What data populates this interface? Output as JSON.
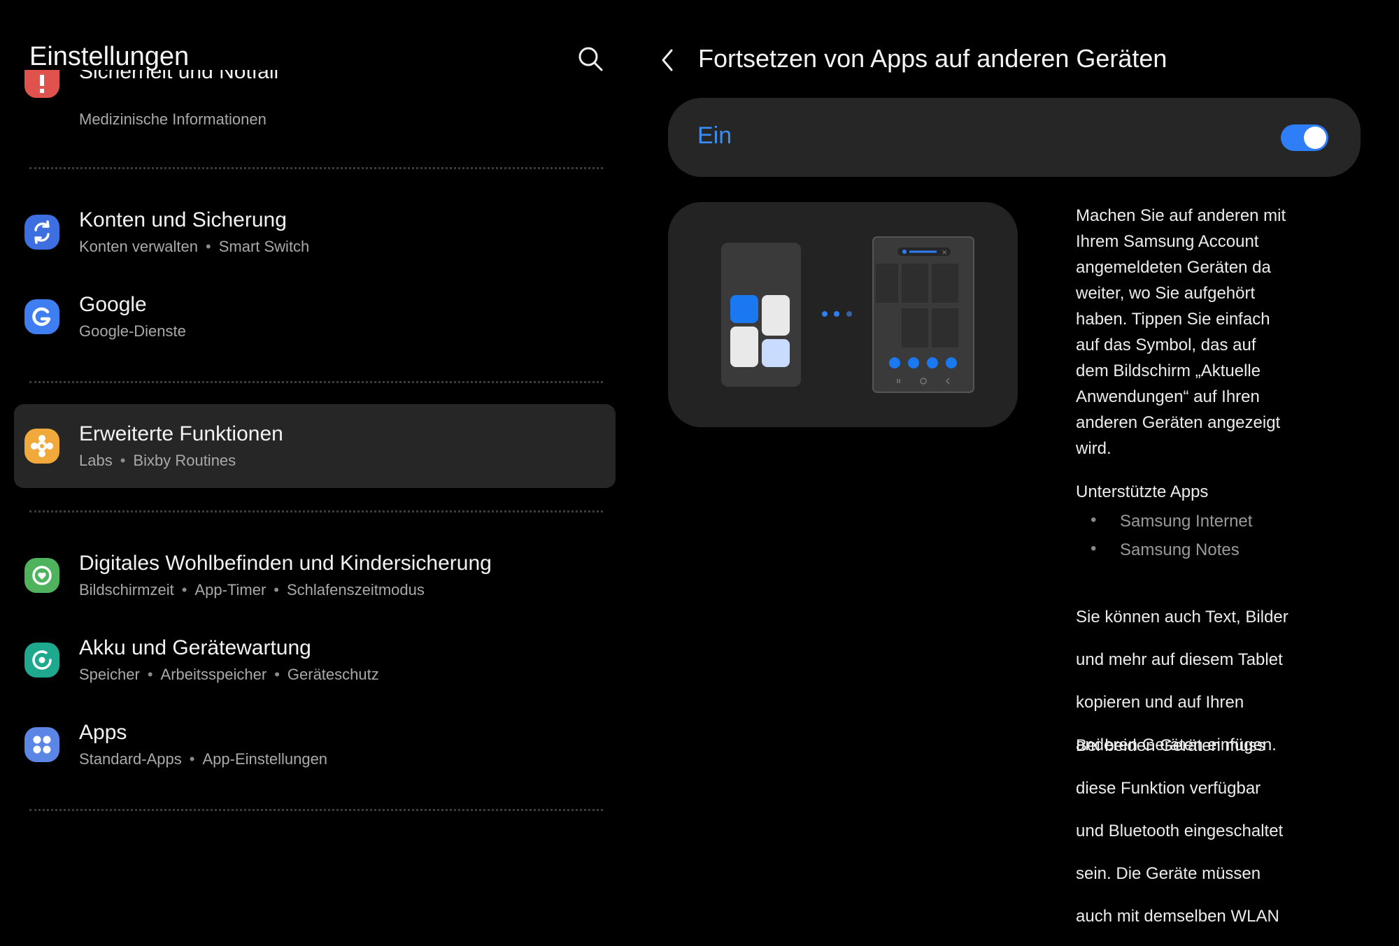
{
  "left": {
    "title": "Einstellungen",
    "partial_item": {
      "title": "Sicherheit und Notfall",
      "subtitle": "Medizinische Informationen"
    },
    "items": [
      {
        "title": "Konten und Sicherung",
        "subtitle": [
          "Konten verwalten",
          "Smart Switch"
        ],
        "icon": "sync-icon",
        "color": "#3d6fe0"
      },
      {
        "title": "Google",
        "subtitle": [
          "Google-Dienste"
        ],
        "icon": "google-icon",
        "color": "#3f7ef0"
      },
      {
        "title": "Erweiterte Funktionen",
        "subtitle": [
          "Labs",
          "Bixby Routines"
        ],
        "icon": "puzzle-gear-icon",
        "color": "#f0a93a",
        "selected": true
      },
      {
        "title": "Digitales Wohlbefinden und Kindersicherung",
        "subtitle": [
          "Bildschirmzeit",
          "App-Timer",
          "Schlafenszeitmodus"
        ],
        "icon": "heart-ring-icon",
        "color": "#4fb35e"
      },
      {
        "title": "Akku und Gerätewartung",
        "subtitle": [
          "Speicher",
          "Arbeitsspeicher",
          "Geräteschutz"
        ],
        "icon": "device-care-icon",
        "color": "#1ea88e"
      },
      {
        "title": "Apps",
        "subtitle": [
          "Standard-Apps",
          "App-Einstellungen"
        ],
        "icon": "apps-grid-icon",
        "color": "#5b86e6"
      }
    ]
  },
  "right": {
    "title": "Fortsetzen von Apps auf anderen Geräten",
    "toggle": {
      "label": "Ein",
      "state": "on",
      "color": "#2d7ef7"
    },
    "description": [
      "Machen Sie auf anderen mit",
      "Ihrem Samsung Account",
      "angemeldeten Geräten da",
      "weiter, wo Sie aufgehört",
      "haben. Tippen Sie einfach",
      "auf das Symbol, das auf",
      "dem Bildschirm „Aktuelle",
      "Anwendungen“ auf Ihren",
      "anderen Geräten angezeigt",
      "wird."
    ],
    "supported_title": "Unterstützte Apps",
    "supported_apps": [
      "Samsung Internet",
      "Samsung Notes"
    ],
    "paragraph2": [
      "Sie können auch Text, Bilder",
      "und mehr auf diesem Tablet",
      "kopieren und auf Ihren",
      "anderen Geräten einfügen."
    ],
    "paragraph3": [
      "Bei beiden Geräten muss",
      "diese Funktion verfügbar",
      "und Bluetooth eingeschaltet",
      "sein. Die Geräte müssen",
      "auch mit demselben WLAN"
    ]
  }
}
